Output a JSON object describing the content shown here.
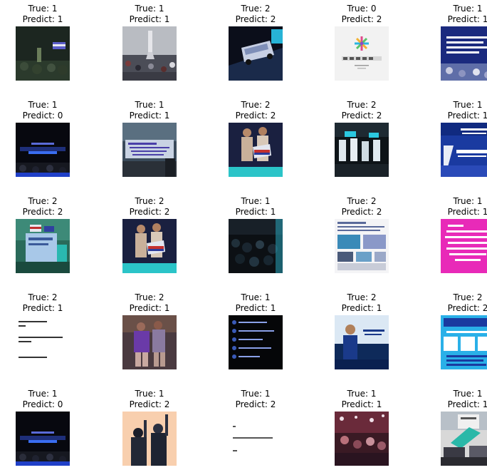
{
  "true_prefix": "True: ",
  "pred_prefix": "Predict: ",
  "grid": [
    [
      {
        "true": "1",
        "pred": "1",
        "thumb": "night-crowd-flag"
      },
      {
        "true": "1",
        "pred": "1",
        "thumb": "monument-crowd"
      },
      {
        "true": "2",
        "pred": "2",
        "thumb": "vehicle-night"
      },
      {
        "true": "0",
        "pred": "2",
        "thumb": "voice-tv-logo"
      },
      {
        "true": "1",
        "pred": "1",
        "thumb": "blue-text-banner"
      }
    ],
    [
      {
        "true": "1",
        "pred": "0",
        "thumb": "dark-stage-banner"
      },
      {
        "true": "1",
        "pred": "1",
        "thumb": "protest-signage"
      },
      {
        "true": "2",
        "pred": "2",
        "thumb": "people-with-flag"
      },
      {
        "true": "2",
        "pred": "2",
        "thumb": "night-procession"
      },
      {
        "true": "1",
        "pred": "1",
        "thumb": "blue-poster"
      }
    ],
    [
      {
        "true": "2",
        "pred": "2",
        "thumb": "sign-with-flags"
      },
      {
        "true": "2",
        "pred": "2",
        "thumb": "people-with-flag"
      },
      {
        "true": "1",
        "pred": "1",
        "thumb": "dark-crowd"
      },
      {
        "true": "2",
        "pred": "2",
        "thumb": "web-collage"
      },
      {
        "true": "1",
        "pred": "1",
        "thumb": "magenta-text"
      }
    ],
    [
      {
        "true": "2",
        "pred": "1",
        "thumb": "white-text-post"
      },
      {
        "true": "2",
        "pred": "1",
        "thumb": "people-purple"
      },
      {
        "true": "1",
        "pred": "1",
        "thumb": "chat-screenshot"
      },
      {
        "true": "2",
        "pred": "1",
        "thumb": "speaker-blue"
      },
      {
        "true": "2",
        "pred": "2",
        "thumb": "cyan-infographic"
      }
    ],
    [
      {
        "true": "1",
        "pred": "0",
        "thumb": "dark-stage-banner"
      },
      {
        "true": "1",
        "pred": "2",
        "thumb": "peach-silhouettes"
      },
      {
        "true": "1",
        "pred": "2",
        "thumb": "white-text-small"
      },
      {
        "true": "1",
        "pred": "1",
        "thumb": "street-night-lights"
      },
      {
        "true": "1",
        "pred": "1",
        "thumb": "cars-sign"
      }
    ]
  ]
}
